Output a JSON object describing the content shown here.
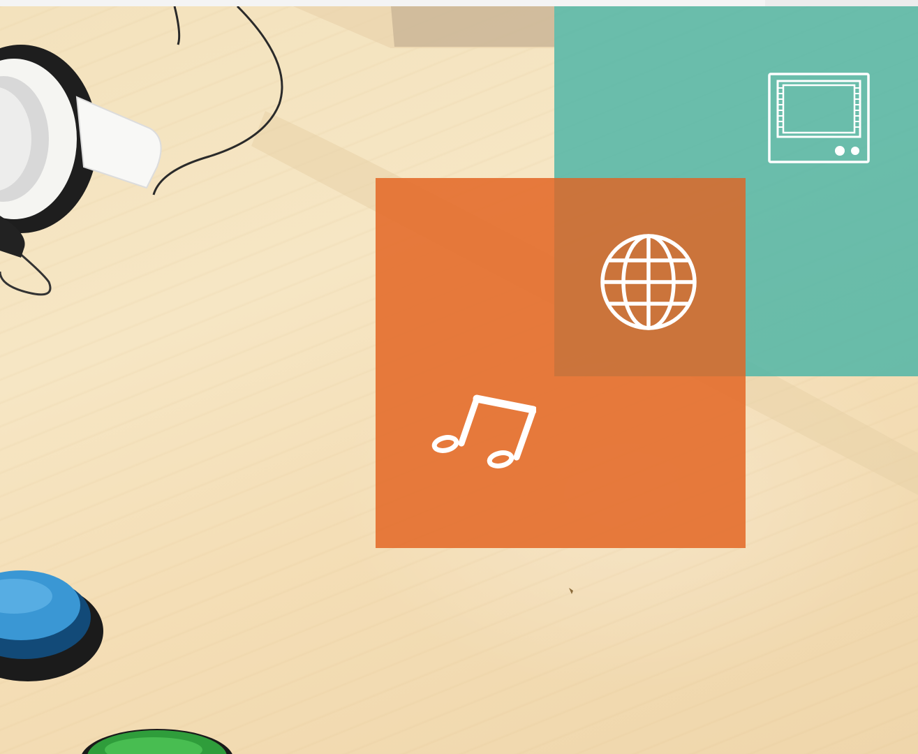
{
  "background": {
    "description_icon": "desk-photo",
    "objects": [
      "headphones",
      "blue-arcade-button",
      "green-arcade-button"
    ]
  },
  "colors": {
    "teal_tile": "#4db5a6",
    "orange_tile": "#e47030",
    "icon_stroke": "#ffffff",
    "wood": "#f3e2bd"
  },
  "tiles": [
    {
      "id": "teal",
      "icon": "tv-icon"
    },
    {
      "id": "orange",
      "icon": "music-note-icon"
    },
    {
      "id": "overlap",
      "icon": "globe-icon"
    }
  ]
}
